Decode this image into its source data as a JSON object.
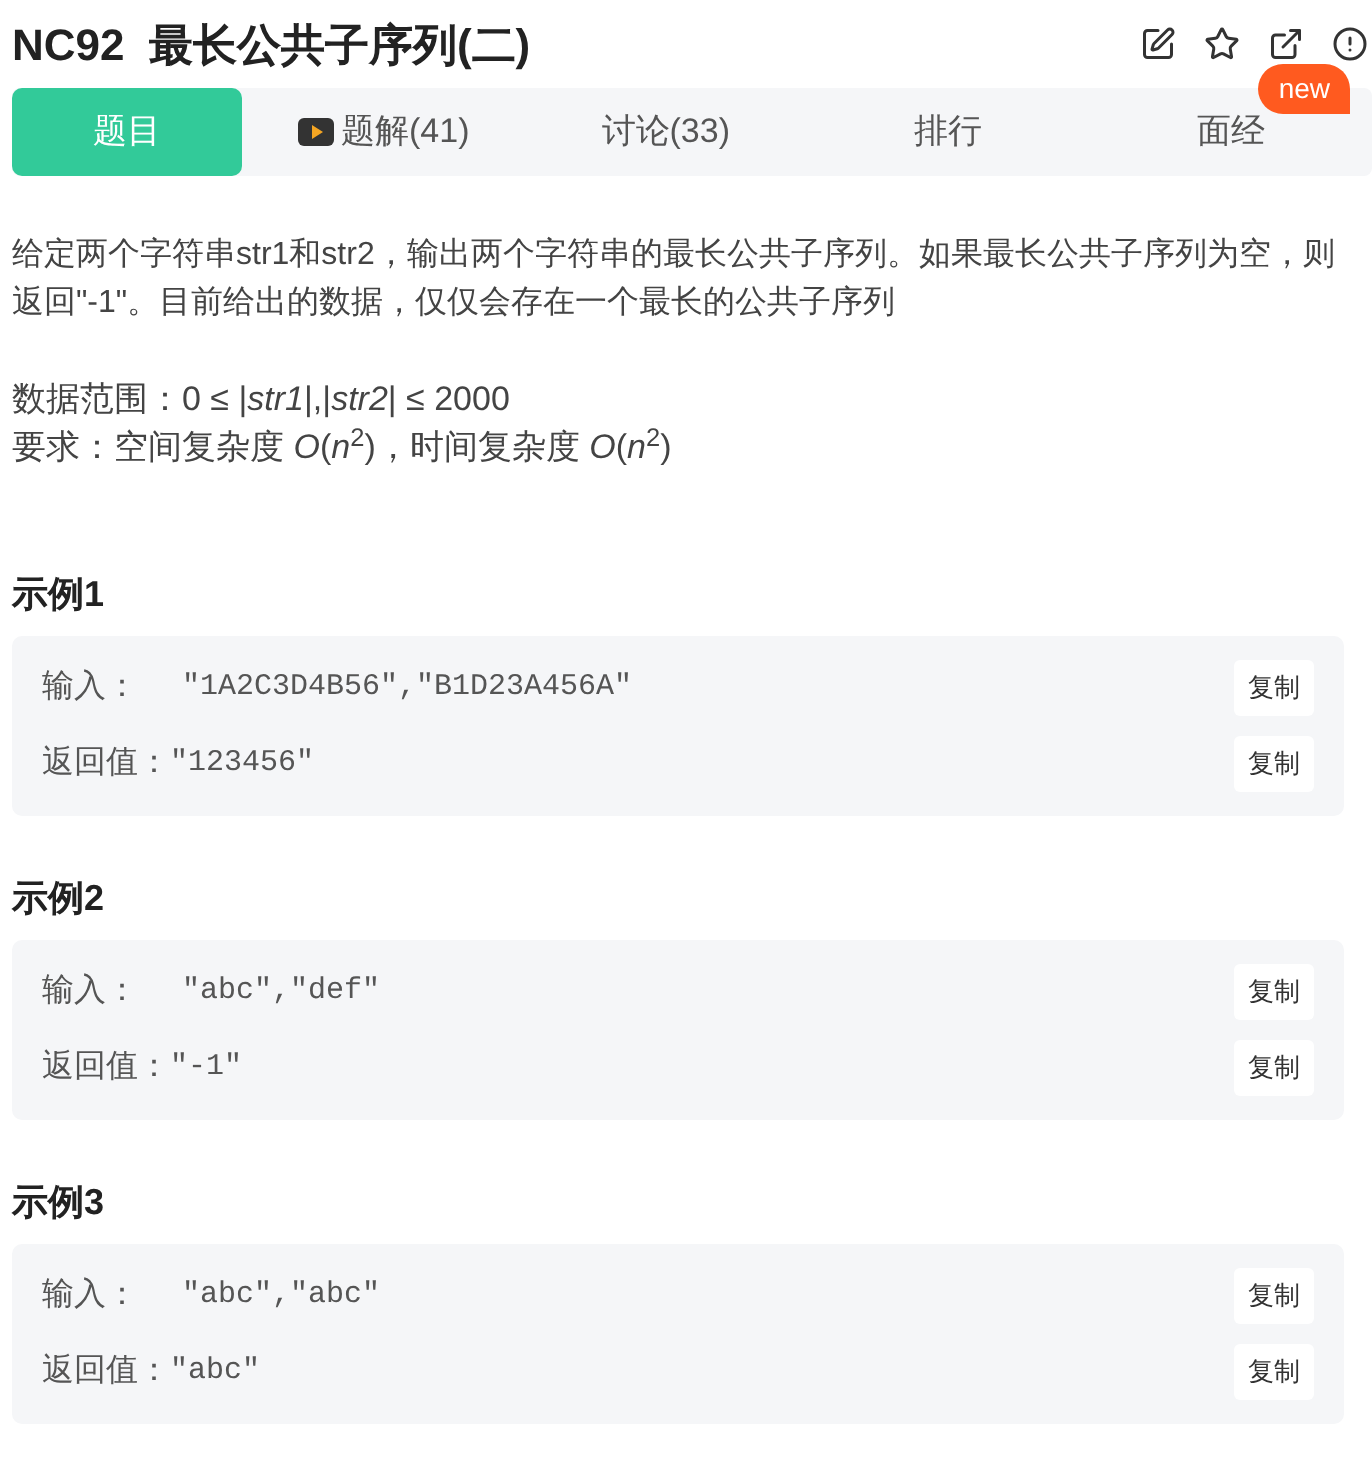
{
  "title": "NC92  最长公共子序列(二)",
  "tabs": [
    {
      "label": "题目",
      "selected": true,
      "video": false
    },
    {
      "label": "题解(41)",
      "selected": false,
      "video": true
    },
    {
      "label": "讨论(33)",
      "selected": false,
      "video": false
    },
    {
      "label": "排行",
      "selected": false,
      "video": false
    },
    {
      "label": "面经",
      "selected": false,
      "video": false
    }
  ],
  "new_badge": "new",
  "description": "给定两个字符串str1和str2，输出两个字符串的最长公共子序列。如果最长公共子序列为空，则返回\"-1\"。目前给出的数据，仅仅会存在一个最长的公共子序列",
  "range": "数据范围：0 ≤ |*str1*|,|*str2*| ≤ 2000",
  "requirement": "要求：空间复杂度 *O*(*n*$^{2}$)，时间复杂度 *O*(*n*$^{2}$)",
  "examples": [
    {
      "heading": "示例1",
      "rows": [
        {
          "label": "输入：",
          "value": "\"1A2C3D4B56\",\"B1D23A456A\"",
          "copy": "复制"
        },
        {
          "label": "返回值：",
          "value": "\"123456\"",
          "copy": "复制"
        }
      ]
    },
    {
      "heading": "示例2",
      "rows": [
        {
          "label": "输入：",
          "value": "\"abc\",\"def\"",
          "copy": "复制"
        },
        {
          "label": "返回值：",
          "value": "\"-1\"",
          "copy": "复制"
        }
      ]
    },
    {
      "heading": "示例3",
      "rows": [
        {
          "label": "输入：",
          "value": "\"abc\",\"abc\"",
          "copy": "复制"
        },
        {
          "label": "返回值：",
          "value": "\"abc\"",
          "copy": "复制"
        }
      ]
    }
  ]
}
